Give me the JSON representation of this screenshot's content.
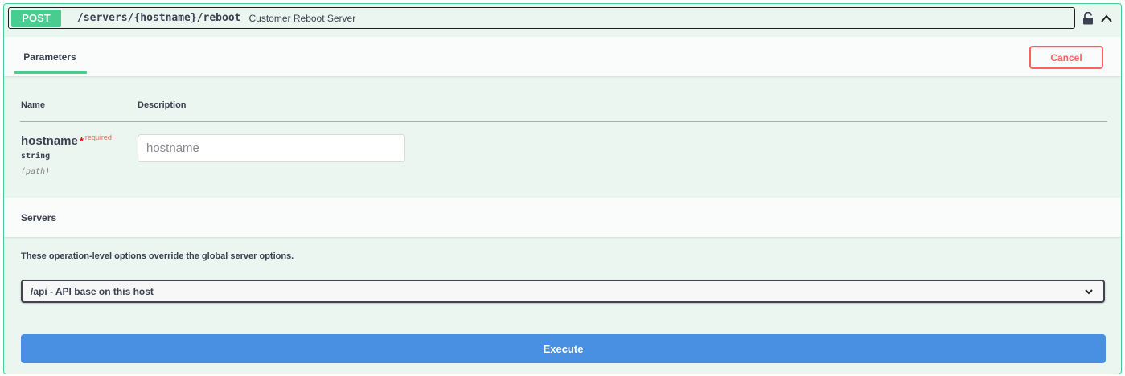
{
  "operation": {
    "method": "POST",
    "path": "/servers/{hostname}/reboot",
    "summary": "Customer Reboot Server",
    "lock_icon": "lock-icon",
    "collapse_icon": "chevron-up-icon"
  },
  "parameters": {
    "tab_label": "Parameters",
    "cancel_label": "Cancel",
    "columns": {
      "name": "Name",
      "description": "Description"
    },
    "items": [
      {
        "name": "hostname",
        "required_star": "*",
        "required_label": "required",
        "type": "string",
        "in": "(path)",
        "value": "",
        "placeholder": "hostname"
      }
    ]
  },
  "servers": {
    "title": "Servers",
    "description": "These operation-level options override the global server options.",
    "selected": "/api - API base on this host"
  },
  "execute_label": "Execute",
  "colors": {
    "post_green": "#49cc90",
    "block_bg": "#ebf6f0",
    "cancel_red": "#ff6060",
    "execute_blue": "#4990e2"
  }
}
